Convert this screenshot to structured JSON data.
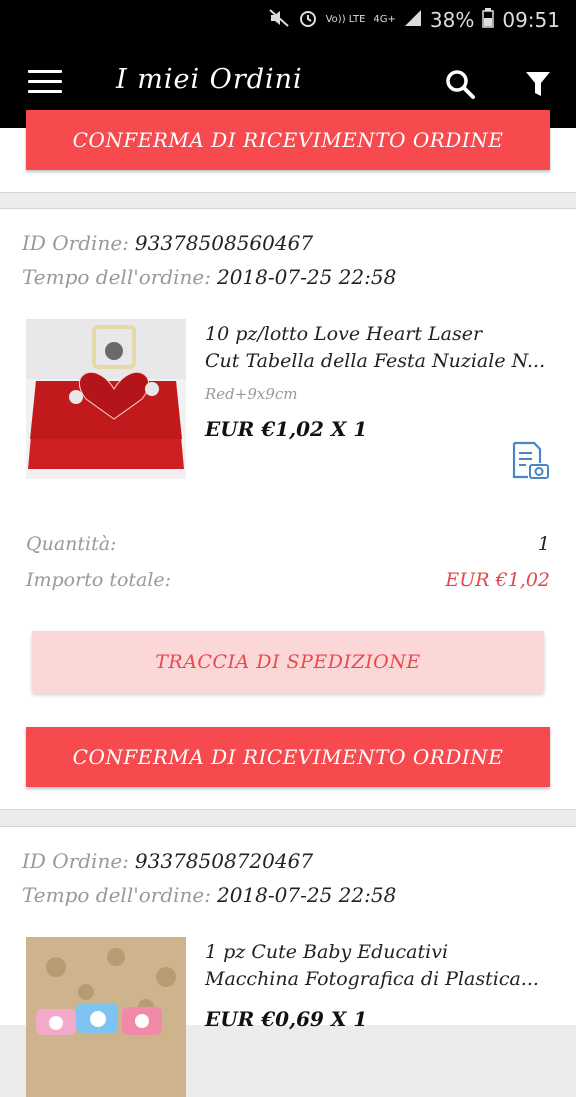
{
  "status_bar": {
    "network_top": "Vo)) LTE",
    "network_4g": "4G+",
    "battery": "38%",
    "time": "09:51"
  },
  "app_bar": {
    "title": "I miei Ordini",
    "icons": [
      "menu-icon",
      "search-icon",
      "filter-icon"
    ]
  },
  "top_card": {
    "confirm_label": "CONFERMA DI RICEVIMENTO ORDINE"
  },
  "orders": [
    {
      "id_label": "ID Ordine:",
      "id_value": "93378508560467",
      "time_label": "Tempo dell'ordine:",
      "time_value": "2018-07-25 22:58",
      "product_title_line1": "10 pz/lotto Love Heart Laser",
      "product_title_line2": "Cut Tabella della Festa Nuziale N...",
      "variant": "Red+9x9cm",
      "price_qty": "EUR €1,02 X 1",
      "quantity_label": "Quantità:",
      "quantity_value": "1",
      "total_label": "Importo totale:",
      "total_value": "EUR €1,02",
      "track_label": "TRACCIA DI SPEDIZIONE",
      "confirm_label": "CONFERMA DI RICEVIMENTO ORDINE"
    },
    {
      "id_label": "ID Ordine:",
      "id_value": "93378508720467",
      "time_label": "Tempo dell'ordine:",
      "time_value": "2018-07-25 22:58",
      "product_title_line1": "1 pz Cute Baby Educativi",
      "product_title_line2": "Macchina Fotografica di Plastica...",
      "price_qty": "EUR €0,69 X 1"
    }
  ],
  "colors": {
    "accent_red": "#f74a4e",
    "track_bg": "#fbd7d7",
    "track_text": "#e84a4f",
    "label_gray": "#999999",
    "icon_blue": "#4a86c5"
  }
}
